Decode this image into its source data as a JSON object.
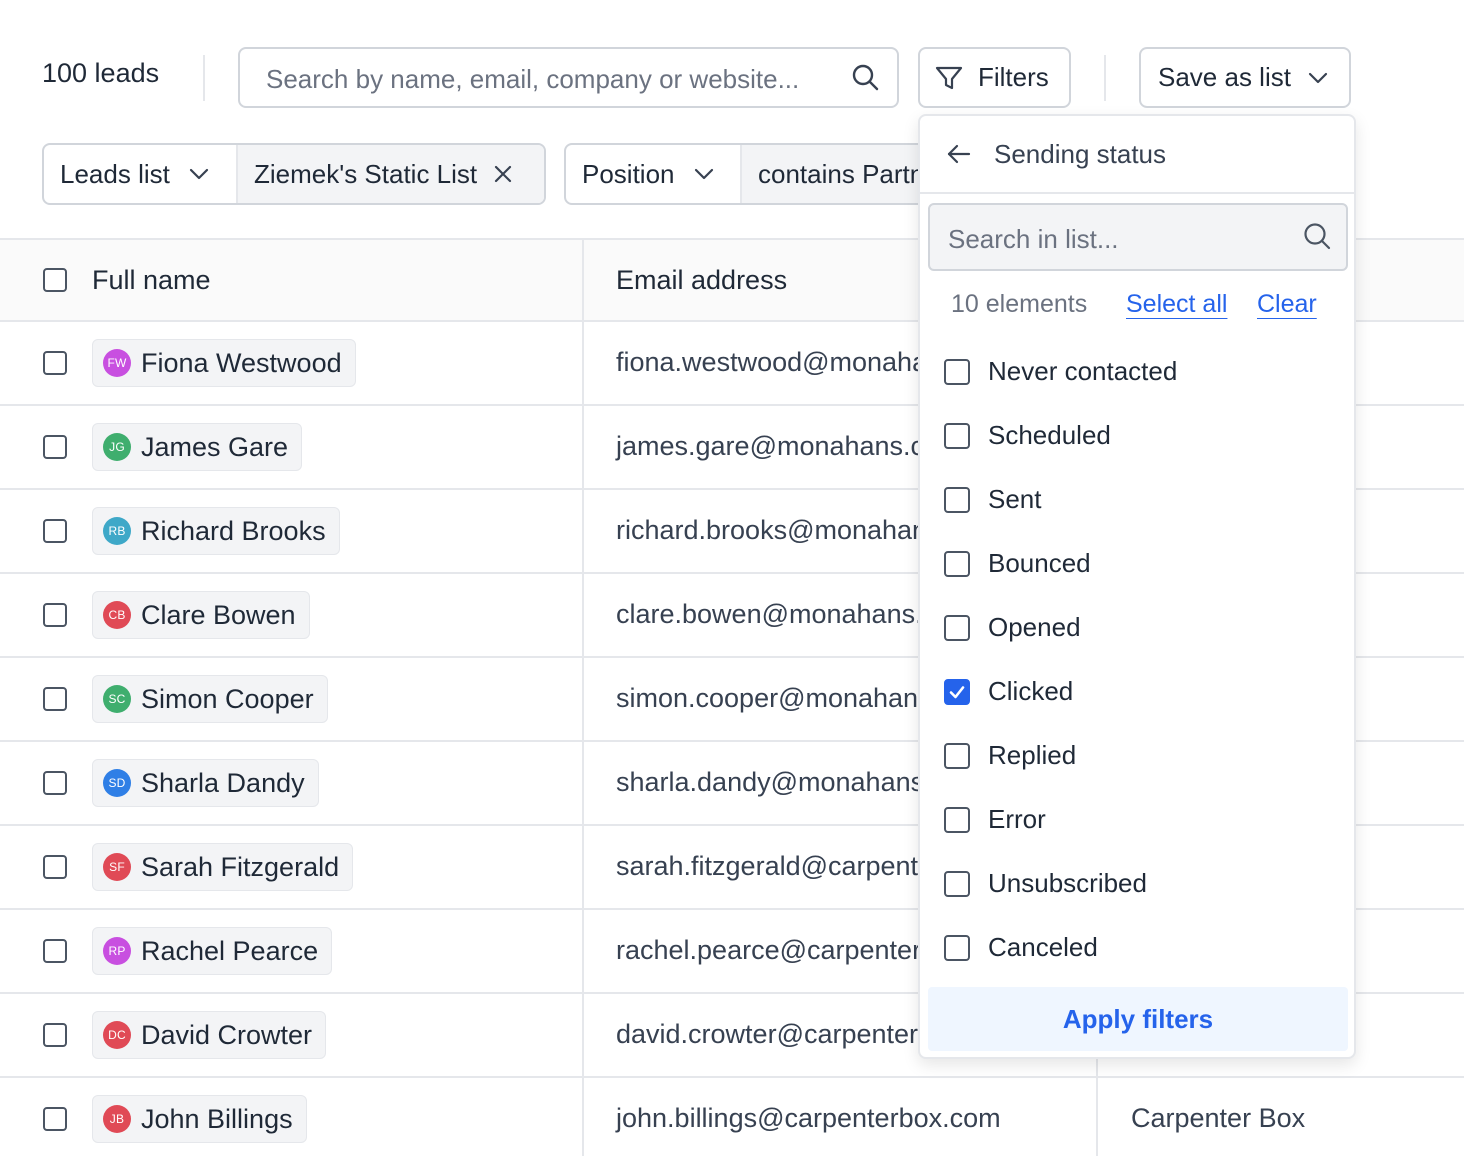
{
  "toolbar": {
    "lead_count": "100 leads",
    "search_placeholder": "Search by name, email, company or website...",
    "filters_label": "Filters",
    "save_label": "Save as list"
  },
  "filter_chips": [
    {
      "field": "Leads list",
      "value": "Ziemek's Static List"
    },
    {
      "field": "Position",
      "value": "contains Partner"
    }
  ],
  "table": {
    "headers": {
      "full_name": "Full name",
      "email": "Email address"
    },
    "rows": [
      {
        "initials": "FW",
        "avatar_color": "#c84fe0",
        "name": "Fiona Westwood",
        "email": "fiona.westwood@monahans.com",
        "company": ""
      },
      {
        "initials": "JG",
        "avatar_color": "#3fae6e",
        "name": "James Gare",
        "email": "james.gare@monahans.com",
        "company": ""
      },
      {
        "initials": "RB",
        "avatar_color": "#3ea8c8",
        "name": "Richard Brooks",
        "email": "richard.brooks@monahans.com",
        "company": ""
      },
      {
        "initials": "CB",
        "avatar_color": "#e04a56",
        "name": "Clare Bowen",
        "email": "clare.bowen@monahans.com",
        "company": ""
      },
      {
        "initials": "SC",
        "avatar_color": "#3fae6e",
        "name": "Simon Cooper",
        "email": "simon.cooper@monahans.com",
        "company": ""
      },
      {
        "initials": "SD",
        "avatar_color": "#2f7fe6",
        "name": "Sharla Dandy",
        "email": "sharla.dandy@monahans.com",
        "company": ""
      },
      {
        "initials": "SF",
        "avatar_color": "#e04a56",
        "name": "Sarah Fitzgerald",
        "email": "sarah.fitzgerald@carpenterbox.com",
        "company": ""
      },
      {
        "initials": "RP",
        "avatar_color": "#c84fe0",
        "name": "Rachel Pearce",
        "email": "rachel.pearce@carpenterbox.com",
        "company": ""
      },
      {
        "initials": "DC",
        "avatar_color": "#e04a56",
        "name": "David Crowter",
        "email": "david.crowter@carpenterbox.com",
        "company": ""
      },
      {
        "initials": "JB",
        "avatar_color": "#e04a56",
        "name": "John Billings",
        "email": "john.billings@carpenterbox.com",
        "company": "Carpenter Box"
      }
    ]
  },
  "dropdown": {
    "title": "Sending status",
    "search_placeholder": "Search in list...",
    "count": "10 elements",
    "select_all": "Select all",
    "clear": "Clear",
    "options": [
      {
        "label": "Never contacted",
        "checked": false
      },
      {
        "label": "Scheduled",
        "checked": false
      },
      {
        "label": "Sent",
        "checked": false
      },
      {
        "label": "Bounced",
        "checked": false
      },
      {
        "label": "Opened",
        "checked": false
      },
      {
        "label": "Clicked",
        "checked": true
      },
      {
        "label": "Replied",
        "checked": false
      },
      {
        "label": "Error",
        "checked": false
      },
      {
        "label": "Unsubscribed",
        "checked": false
      },
      {
        "label": "Canceled",
        "checked": false
      }
    ],
    "apply_label": "Apply filters"
  },
  "icons": {
    "search": "search-icon",
    "filter": "filter-icon",
    "chevron": "chevron-down-icon",
    "close": "close-icon",
    "back": "arrow-left-icon",
    "check": "check-icon"
  },
  "colors": {
    "accent": "#2563eb",
    "border": "#d1d5db"
  }
}
